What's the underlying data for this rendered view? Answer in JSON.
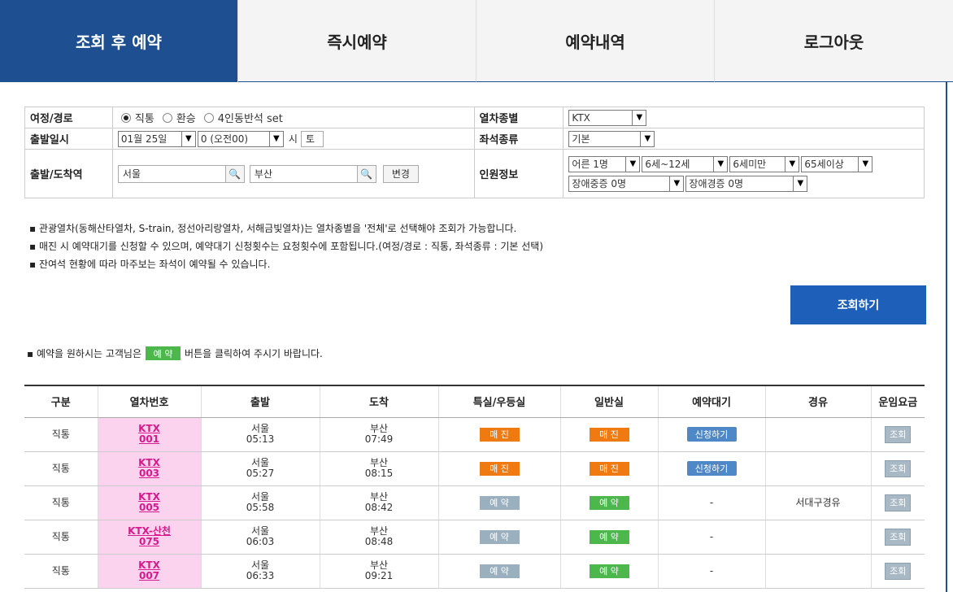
{
  "tabs": [
    {
      "label": "조회 후 예약",
      "active": true
    },
    {
      "label": "즉시예약",
      "active": false
    },
    {
      "label": "예약내역",
      "active": false
    },
    {
      "label": "로그아웃",
      "active": false
    }
  ],
  "form": {
    "route_label": "여정/경로",
    "route_options": [
      "직통",
      "환승",
      "4인동반석 set"
    ],
    "route_selected": "직통",
    "date_label": "출발일시",
    "date_value": "01월 25일",
    "time_value": "0 (오전00)",
    "time_suffix": "시",
    "weekday": "토",
    "station_label": "출발/도착역",
    "departure": "서울",
    "arrival": "부산",
    "change_button": "변경",
    "train_type_label": "열차종별",
    "train_type_value": "KTX",
    "seat_type_label": "좌석종류",
    "seat_type_value": "기본",
    "passenger_label": "인원정보",
    "passengers": {
      "adult": "어른 1명",
      "child": "6세~12세",
      "infant": "6세미만",
      "senior": "65세이상",
      "disabled_severe": "장애중증 0명",
      "disabled_mild": "장애경증 0명"
    }
  },
  "notices": [
    "▪ 관광열차(동해산타열차, S-train, 정선아리랑열차, 서해금빛열차)는 열차종별을 '전체'로 선택해야 조회가 가능합니다.",
    "▪ 매진 시 예약대기를 신청할 수 있으며, 예약대기 신청횟수는 요청횟수에 포함됩니다.(여정/경로 : 직통, 좌석종류 : 기본 선택)",
    "▪ 잔여석 현황에 따라 마주보는 좌석이 예약될 수 있습니다."
  ],
  "search_button": "조회하기",
  "book_hint": {
    "before": "▪ 예약을 원하시는 고객님은",
    "button": "예 약",
    "after": "버튼을 클릭하여 주시기 바랍니다."
  },
  "table": {
    "headers": [
      "구분",
      "열차번호",
      "출발",
      "도착",
      "특실/우등실",
      "일반실",
      "예약대기",
      "경유",
      "운임요금"
    ],
    "rows": [
      {
        "kind": "직통",
        "train_line1": "KTX",
        "train_line2": "001",
        "dep_station": "서울",
        "dep_time": "05:13",
        "arr_station": "부산",
        "arr_time": "07:49",
        "special": "매 진",
        "special_state": "sold",
        "general": "매 진",
        "general_state": "sold",
        "wait": "신청하기",
        "via": "",
        "fare": "조회"
      },
      {
        "kind": "직통",
        "train_line1": "KTX",
        "train_line2": "003",
        "dep_station": "서울",
        "dep_time": "05:27",
        "arr_station": "부산",
        "arr_time": "08:15",
        "special": "매 진",
        "special_state": "sold",
        "general": "매 진",
        "general_state": "sold",
        "wait": "신청하기",
        "via": "",
        "fare": "조회"
      },
      {
        "kind": "직통",
        "train_line1": "KTX",
        "train_line2": "005",
        "dep_station": "서울",
        "dep_time": "05:58",
        "arr_station": "부산",
        "arr_time": "08:42",
        "special": "예 약",
        "special_state": "grey",
        "general": "예 약",
        "general_state": "green",
        "wait": "-",
        "via": "서대구경유",
        "fare": "조회"
      },
      {
        "kind": "직통",
        "train_line1": "KTX-산천",
        "train_line2": "075",
        "dep_station": "서울",
        "dep_time": "06:03",
        "arr_station": "부산",
        "arr_time": "08:48",
        "special": "예 약",
        "special_state": "grey",
        "general": "예 약",
        "general_state": "green",
        "wait": "-",
        "via": "",
        "fare": "조회"
      },
      {
        "kind": "직통",
        "train_line1": "KTX",
        "train_line2": "007",
        "dep_station": "서울",
        "dep_time": "06:33",
        "arr_station": "부산",
        "arr_time": "09:21",
        "special": "예 약",
        "special_state": "grey",
        "general": "예 약",
        "general_state": "green",
        "wait": "-",
        "via": "",
        "fare": "조회"
      }
    ]
  },
  "colors": {
    "primary": "#1d4f91",
    "search_button": "#1d5fb9",
    "sold_out": "#ef7a12",
    "reserve_green": "#4cb84c",
    "reserve_grey": "#9bb0bf",
    "train_cell": "#fbd3ee",
    "train_link": "#d6198c"
  },
  "icons": {
    "search": "magnifier-icon",
    "dropdown": "chevron-down-icon"
  }
}
